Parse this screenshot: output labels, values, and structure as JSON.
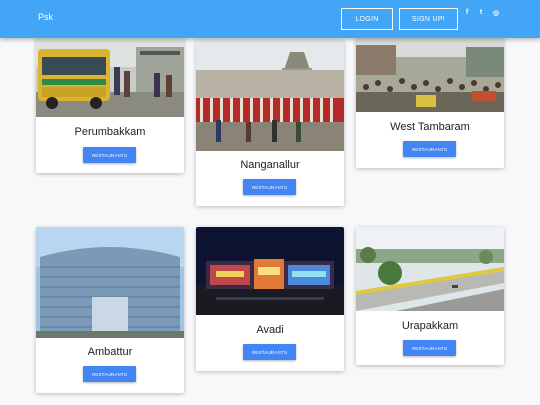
{
  "navbar": {
    "brand": "Psk",
    "login_label": "LOGIN",
    "signup_label": "SIGN UP!",
    "social_icons": [
      "facebook-icon",
      "twitter-icon",
      "instagram-icon"
    ],
    "social_glyphs": [
      "f",
      "t",
      "◎"
    ],
    "background_color": "#42a5f5"
  },
  "cards": [
    {
      "name": "Perumbakkam",
      "button_label": "RESTAURANTS"
    },
    {
      "name": "Nanganallur",
      "button_label": "RESTAURANTS"
    },
    {
      "name": "West Tambaram",
      "button_label": "RESTAURANTS"
    },
    {
      "name": "Ambattur",
      "button_label": "RESTAURANTS"
    },
    {
      "name": "Avadi",
      "button_label": "RESTAURANTS"
    },
    {
      "name": "Urapakkam",
      "button_label": "RESTAURANTS"
    }
  ],
  "button_color": "#4285f4"
}
